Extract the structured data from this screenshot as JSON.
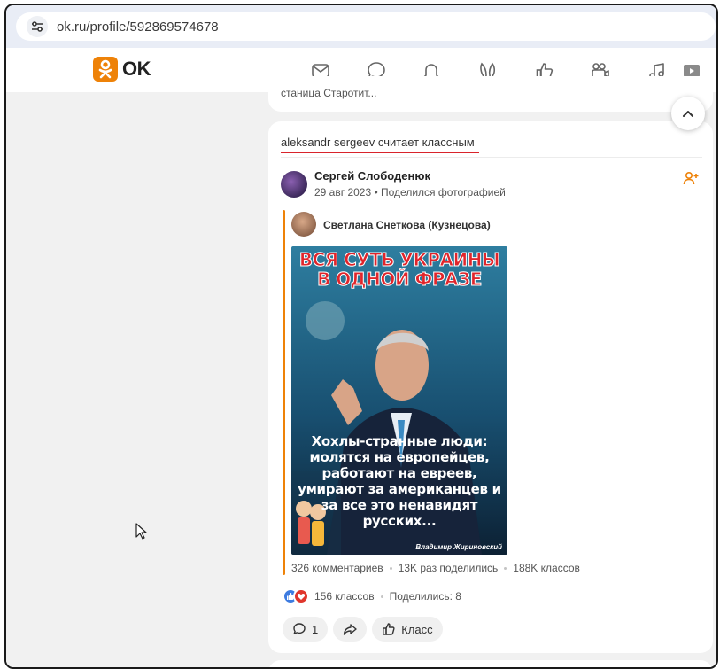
{
  "browser": {
    "url": "ok.ru/profile/592869574678"
  },
  "header": {
    "logo_text": "OK",
    "nav_icons": [
      "messages-icon",
      "discussions-icon",
      "notifications-icon",
      "guests-icon",
      "events-icon",
      "video-icon",
      "music-icon",
      "video-player-icon"
    ]
  },
  "previous_post": {
    "snippet": "станица Старотит..."
  },
  "post": {
    "reason": "aleksandr sergeev считает классным",
    "author": "Сергей Слободенюк",
    "meta": "29 авг 2023 • Поделился фотографией",
    "original_author": "Светлана Снеткова (Кузнецова)",
    "photo": {
      "top_text": "ВСЯ СУТЬ УКРАИНЫ В ОДНОЙ ФРАЗЕ",
      "bottom_text": "Хохлы-странные люди: молятся на европейцев, работают на евреев, умирают за американцев и за все это ненавидят русских...",
      "signature": "Владимир Жириновский"
    },
    "stats": {
      "comments": "326 комментариев",
      "shares": "13K раз поделились",
      "likes": "188K классов"
    },
    "reactions": {
      "likes": "156 классов",
      "shared": "Поделились: 8"
    },
    "actions": {
      "comments_count": "1",
      "like_label": "Класс"
    }
  },
  "colors": {
    "brand": "#ee8208",
    "accent_red": "#d9242b",
    "background": "#f1f1f1"
  }
}
